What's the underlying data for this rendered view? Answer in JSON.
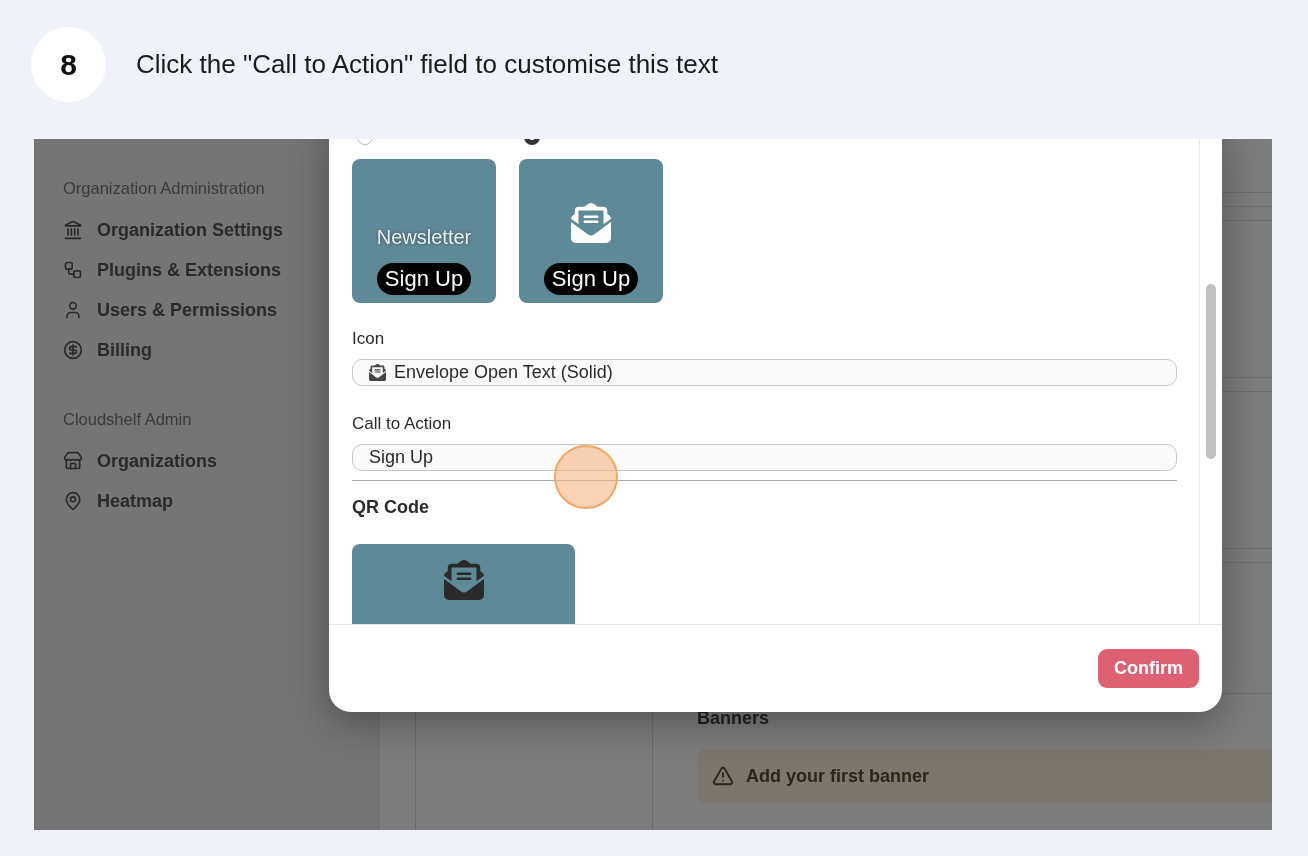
{
  "step": {
    "number": "8",
    "instruction": "Click the \"Call to Action\" field to customise this text"
  },
  "sidebar": {
    "sections": [
      {
        "title": "Organization Administration",
        "items": [
          {
            "label": "Organization Settings"
          },
          {
            "label": "Plugins & Extensions"
          },
          {
            "label": "Users & Permissions"
          },
          {
            "label": "Billing"
          }
        ]
      },
      {
        "title": "Cloudshelf Admin",
        "items": [
          {
            "label": "Organizations"
          },
          {
            "label": "Heatmap"
          }
        ]
      }
    ]
  },
  "banners": {
    "heading": "Banners",
    "alert": "Add your first banner"
  },
  "modal": {
    "layouts": [
      {
        "kind": "text",
        "title": "Newsletter",
        "cta": "Sign Up",
        "selected": false
      },
      {
        "kind": "icon",
        "cta": "Sign Up",
        "selected": true
      }
    ],
    "fields": [
      {
        "kind": "icon-select",
        "label": "Icon",
        "value": "Envelope Open Text (Solid)"
      },
      {
        "kind": "text",
        "label": "Call to Action",
        "value": "Sign Up"
      }
    ],
    "qr_heading": "QR Code",
    "confirm": "Confirm"
  }
}
